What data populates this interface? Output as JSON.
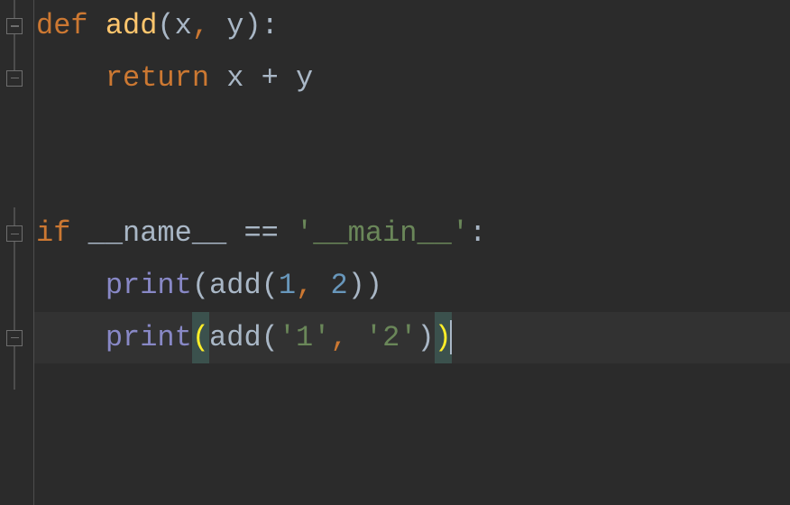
{
  "code": {
    "lines": [
      {
        "tokens": [
          {
            "text": "def ",
            "cls": "kw-orange"
          },
          {
            "text": "add",
            "cls": "fn-yellow"
          },
          {
            "text": "(x",
            "cls": "default"
          },
          {
            "text": ", ",
            "cls": "kw-orange"
          },
          {
            "text": "y):",
            "cls": "default"
          }
        ],
        "fold": true,
        "highlight": false
      },
      {
        "tokens": [
          {
            "text": "    ",
            "cls": "default"
          },
          {
            "text": "return ",
            "cls": "kw-orange"
          },
          {
            "text": "x + y",
            "cls": "default"
          }
        ],
        "fold": true,
        "highlight": false
      },
      {
        "tokens": [],
        "fold": false,
        "highlight": false
      },
      {
        "tokens": [],
        "fold": false,
        "highlight": false
      },
      {
        "tokens": [
          {
            "text": "if ",
            "cls": "kw-orange"
          },
          {
            "text": "__name__ == ",
            "cls": "default"
          },
          {
            "text": "'__main__'",
            "cls": "string"
          },
          {
            "text": ":",
            "cls": "default"
          }
        ],
        "fold": true,
        "highlight": false
      },
      {
        "tokens": [
          {
            "text": "    ",
            "cls": "default"
          },
          {
            "text": "print",
            "cls": "builtin"
          },
          {
            "text": "(add(",
            "cls": "default"
          },
          {
            "text": "1",
            "cls": "number"
          },
          {
            "text": ", ",
            "cls": "kw-orange"
          },
          {
            "text": "2",
            "cls": "number"
          },
          {
            "text": "))",
            "cls": "default"
          }
        ],
        "fold": false,
        "highlight": false
      },
      {
        "tokens": [
          {
            "text": "    ",
            "cls": "default"
          },
          {
            "text": "print",
            "cls": "builtin"
          },
          {
            "text": "(",
            "cls": "paren-match"
          },
          {
            "text": "add(",
            "cls": "default"
          },
          {
            "text": "'1'",
            "cls": "string"
          },
          {
            "text": ", ",
            "cls": "kw-orange"
          },
          {
            "text": "'2'",
            "cls": "string"
          },
          {
            "text": ")",
            "cls": "default"
          },
          {
            "text": ")",
            "cls": "paren-match"
          }
        ],
        "fold": true,
        "highlight": true,
        "cursor": true
      }
    ]
  }
}
